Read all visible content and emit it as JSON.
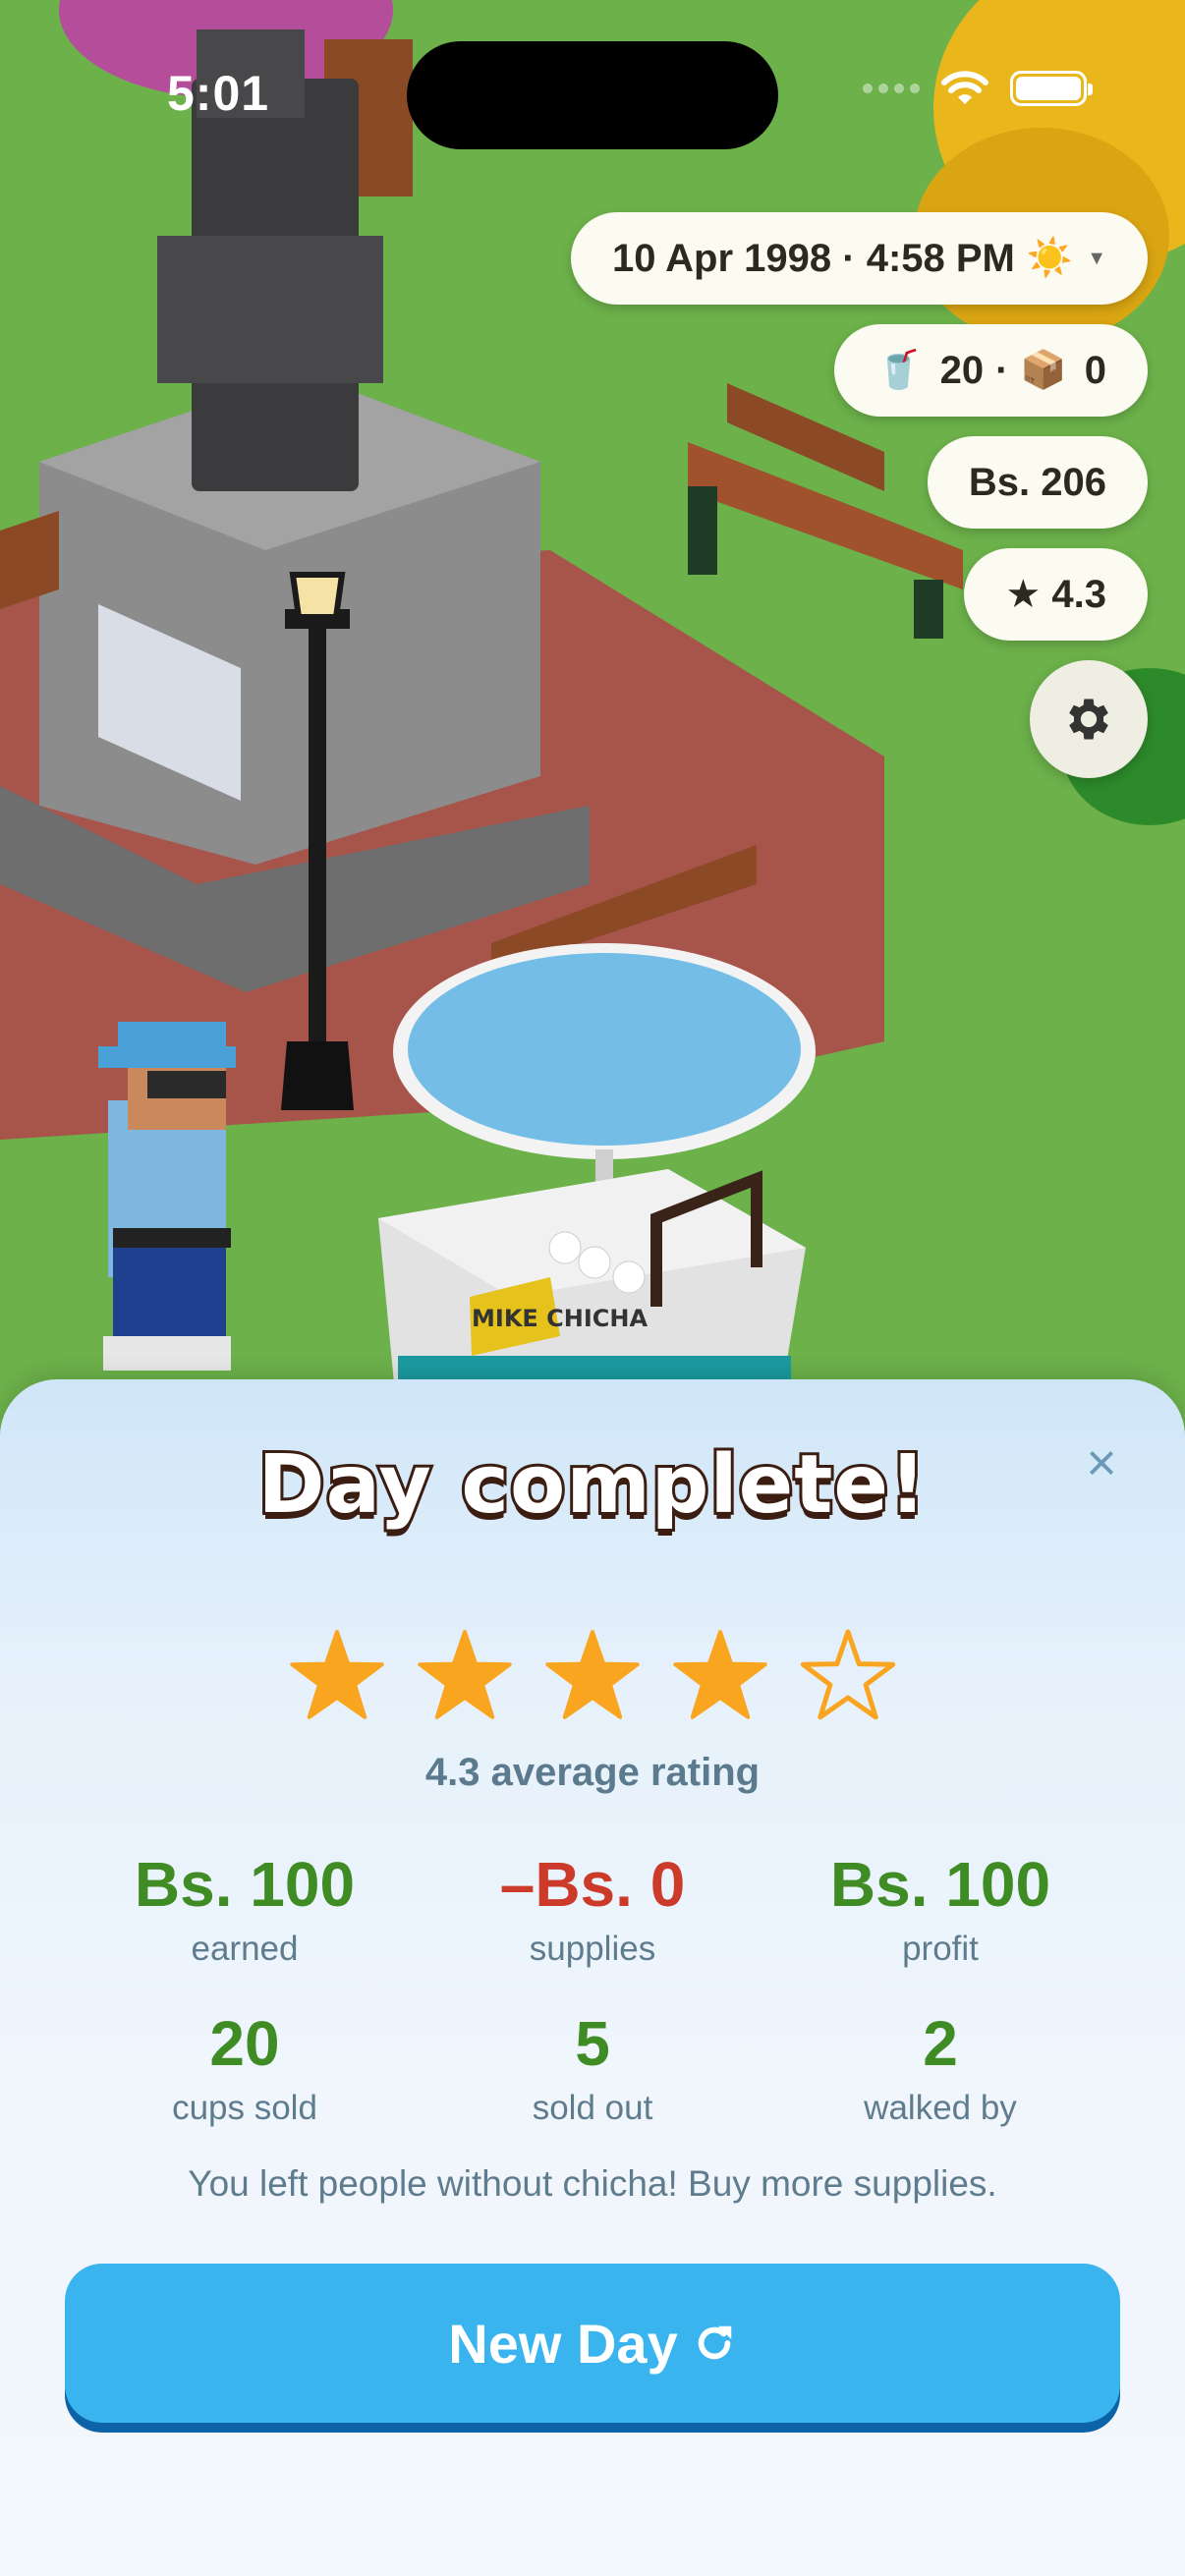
{
  "status_bar": {
    "time": "5:01"
  },
  "hud": {
    "datetime": "10 Apr 1998 · 4:58 PM",
    "weather_emoji": "☀️",
    "cups_emoji": "🥤",
    "cups": "20",
    "box_emoji": "📦",
    "boxes": "0",
    "money": "Bs. 206",
    "rating": "★ 4.3"
  },
  "scene": {
    "stand_sign": "MIKE CHICHA"
  },
  "summary": {
    "title": "Day complete!",
    "close_symbol": "×",
    "stars_filled": 4,
    "stars_total": 5,
    "average_rating_text": "4.3 average rating",
    "stats_row1": [
      {
        "value": "Bs. 100",
        "label": "earned"
      },
      {
        "value": "–Bs. 0",
        "label": "supplies"
      },
      {
        "value": "Bs. 100",
        "label": "profit"
      }
    ],
    "stats_row2": [
      {
        "value": "20",
        "label": "cups sold"
      },
      {
        "value": "5",
        "label": "sold out"
      },
      {
        "value": "2",
        "label": "walked by"
      }
    ],
    "message": "You left people without chicha! Buy more supplies.",
    "new_day_label": "New Day"
  },
  "colors": {
    "star": "#f9a51f",
    "positive": "#3e8c23",
    "negative": "#cc3a2a",
    "button": "#39b4ef",
    "button_shadow": "#0d63a8"
  }
}
